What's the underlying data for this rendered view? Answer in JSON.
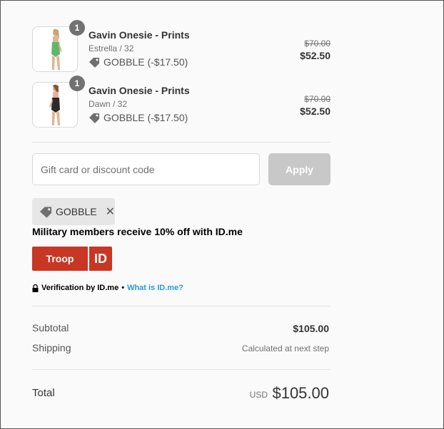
{
  "line_items": [
    {
      "quantity": "1",
      "name": "Gavin Onesie - Prints",
      "variant": "Estrella / 32",
      "discount": "GOBBLE (-$17.50)",
      "original_price": "$70.00",
      "final_price": "$52.50",
      "swimsuit_color": "#5fb86a"
    },
    {
      "quantity": "1",
      "name": "Gavin Onesie - Prints",
      "variant": "Dawn / 32",
      "discount": "GOBBLE (-$17.50)",
      "original_price": "$70.00",
      "final_price": "$52.50",
      "swimsuit_color": "#2b2b2b"
    }
  ],
  "discount_form": {
    "placeholder": "Gift card or discount code",
    "value": "",
    "apply_label": "Apply"
  },
  "applied_code": {
    "label": "GOBBLE",
    "remove_icon": "close-icon"
  },
  "military": {
    "text": "Military members receive 10% off with ID.me",
    "troop_label": "Troop",
    "id_label": "ID",
    "verification_text": "Verification by ID.me",
    "bullet": "•",
    "link_text": "What is ID.me?"
  },
  "summary": {
    "subtotal_label": "Subtotal",
    "subtotal_value": "$105.00",
    "shipping_label": "Shipping",
    "shipping_value": "Calculated at next step",
    "total_label": "Total",
    "currency": "USD",
    "total_value": "$105.00"
  },
  "colors": {
    "troop_red": "#c83624",
    "link_blue": "#2a9ad6",
    "apply_disabled": "#c8c8c8"
  }
}
